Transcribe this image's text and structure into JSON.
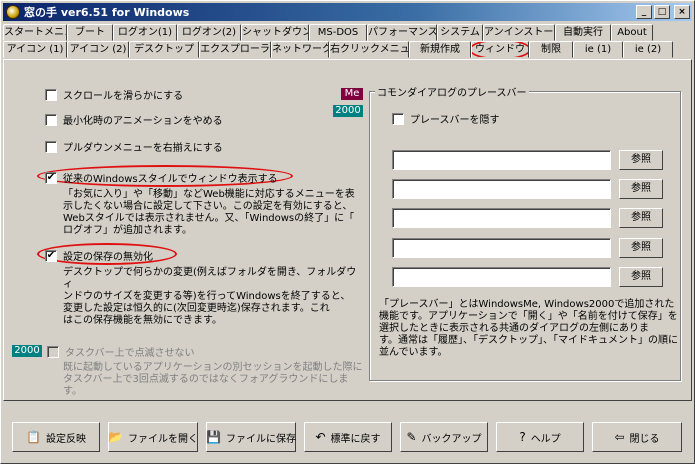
{
  "window": {
    "title": "窓の手  ver6.51  for  Windows",
    "minimize_glyph": "_",
    "maximize_glyph": "□",
    "close_glyph": "×"
  },
  "tabs": {
    "row1": [
      "スタートメニュー",
      "ブート",
      "ログオン(1)",
      "ログオン(2)",
      "シャットダウン",
      "MS-DOS",
      "パフォーマンス",
      "システム",
      "アンインストール",
      "自動実行",
      "About"
    ],
    "row2": [
      "アイコン (1)",
      "アイコン (2)",
      "デスクトップ",
      "エクスプローラ",
      "ネットワーク",
      "右クリックメニュー",
      "新規作成",
      "ウィンドウ",
      "制限",
      "ie (1)",
      "ie (2)"
    ],
    "active": "ウィンドウ"
  },
  "options": {
    "smooth_scroll": {
      "label": "スクロールを滑らかにする",
      "checked": false
    },
    "minimize_anim": {
      "label": "最小化時のアニメーションをやめる",
      "checked": false
    },
    "right_align_menu": {
      "label": "プルダウンメニューを右揃えにする",
      "checked": false
    },
    "classic_style": {
      "label": "従来のWindowsスタイルでウィンドウ表示する",
      "checked": true
    },
    "classic_style_desc": "「お気に入り」や「移動」などWeb機能に対応するメニューを表\n示したくない場合に設定して下さい。この設定を有効にすると、\nWebスタイルでは表示されません。又、「Windowsの終了」に「\nログオフ」が追加されます。",
    "disable_save": {
      "label": "設定の保存の無効化",
      "checked": true
    },
    "disable_save_desc": "デスクトップで何らかの変更(例えばフォルダを開き、フォルダウィ\nンドウのサイズを変更する等)を行ってWindowsを終了すると、\n変更した設定は恒久的に(次回変更時迄)保存されます。これ\nはこの保存機能を無効にできます。",
    "taskbar_flash": {
      "label": "タスクバー上で点滅させない",
      "checked": false,
      "enabled": false
    },
    "taskbar_flash_desc": "既に起動しているアプリケーションの別セッションを起動した際に\nタスクバー上で3回点滅するのではなくフォアグラウンドにします。"
  },
  "badges": {
    "me": "Me",
    "w2000_a": "2000",
    "w2000_b": "2000",
    "me_color": "#800040",
    "w2000_color": "#008080"
  },
  "places_bar": {
    "group_title": "コモンダイアログのプレースバー",
    "hide_label": "プレースバーを隠す",
    "hide_checked": false,
    "fields": [
      "",
      "",
      "",
      "",
      ""
    ],
    "browse_label": "参照",
    "description": "「プレースバー」とはWindowsMe, Windows2000で追加された\n機能です。アプリケーションで「開く」や「名前を付けて保存」を\n選択したときに表示される共通のダイアログの左側にありま\nす。通常は「履歴」、「デスクトップ」、「マイドキュメント」の順に\n並んでいます。"
  },
  "buttons": {
    "apply": "設定反映",
    "open_file": "ファイルを開く",
    "save_file": "ファイルに保存",
    "restore_default": "標準に戻す",
    "backup": "バックアップ",
    "help": "ヘルプ",
    "close": "閉じる"
  }
}
